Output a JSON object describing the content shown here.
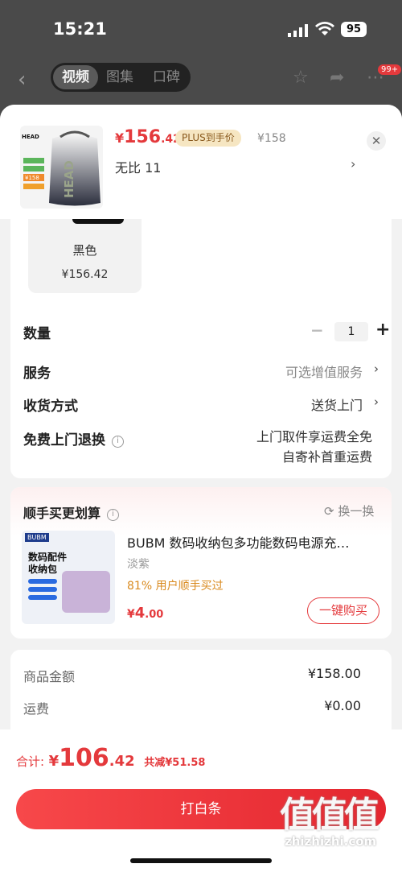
{
  "status_bar": {
    "time": "15:21",
    "battery": "95"
  },
  "background_nav": {
    "tabs": [
      {
        "label": "视频"
      },
      {
        "label": "图集"
      },
      {
        "label": "口碑"
      }
    ],
    "cart_badge": "99+"
  },
  "sheet": {
    "price": {
      "currency": "¥",
      "integer": "156",
      "decimal": ".42"
    },
    "plus_tag": "PLUS到手价",
    "original_price": "¥158",
    "variant": "无比  11",
    "swatch": {
      "name": "黑色",
      "price": "¥156.42"
    },
    "thumb_labels": {
      "brand": "HEAD",
      "badge": "¥158"
    }
  },
  "options": {
    "quantity_label": "数量",
    "quantity_value": "1",
    "service_label": "服务",
    "service_value": "可选增值服务",
    "delivery_label": "收货方式",
    "delivery_value": "送货上门",
    "return_label": "免费上门退换",
    "return_line1": "上门取件享运费全免",
    "return_line2": "自寄补首重运费"
  },
  "addon": {
    "title": "顺手买更划算",
    "refresh_label": "换一换",
    "product_title": "BUBM 数码收纳包多功能数码电源充…",
    "product_variant": "淡紫",
    "product_stat": "81% 用户顺手买过",
    "price": {
      "currency": "¥",
      "integer": "4",
      "decimal": ".00"
    },
    "buy_label": "一键购买",
    "img_brand": "BUBM",
    "img_title_1": "数码配件",
    "img_title_2": "收纳包"
  },
  "summary": {
    "goods_label": "商品金额",
    "goods_value": "¥158.00",
    "shipping_label": "运费",
    "shipping_value": "¥0.00"
  },
  "footer": {
    "total_label": "合计:",
    "total_currency": "¥",
    "total_integer": "106",
    "total_decimal": ".42",
    "saved": "共减¥51.58",
    "pay_label": "打白条"
  },
  "watermark": {
    "glyphs": "值值值",
    "site": "zhizhizhi.com"
  }
}
